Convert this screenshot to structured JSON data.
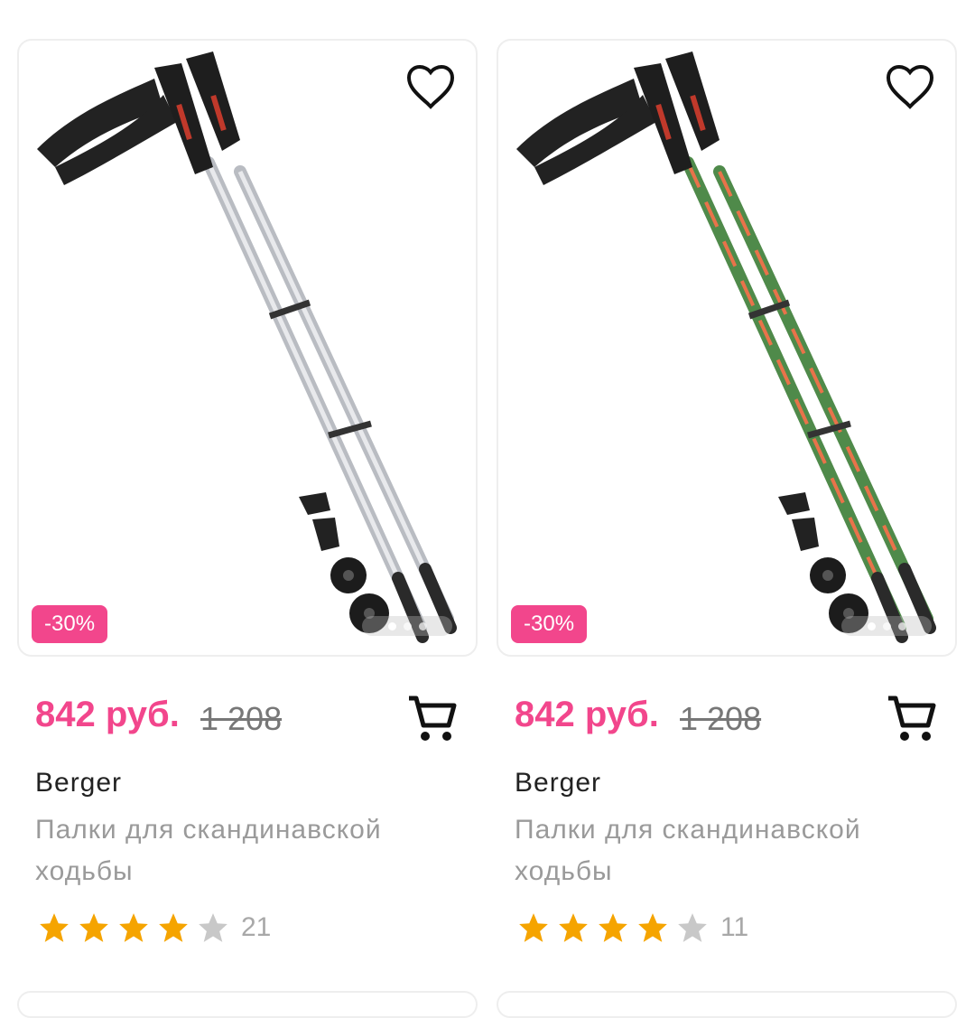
{
  "products": [
    {
      "discount": "-30%",
      "price": "842 руб.",
      "old_price": "1 208",
      "brand": "Berger",
      "title": "Палки для скандинавской ходьбы",
      "rating": 4,
      "rating_max": 5,
      "reviews": "21",
      "shaft_color": "silver",
      "favorite_icon": "heart-outline-icon",
      "cart_icon": "shopping-cart-icon",
      "gallery_index": 1,
      "gallery_total": 3
    },
    {
      "discount": "-30%",
      "price": "842 руб.",
      "old_price": "1 208",
      "brand": "Berger",
      "title": "Палки для скандинавской ходьбы",
      "rating": 4,
      "rating_max": 5,
      "reviews": "11",
      "shaft_color": "green-orange",
      "favorite_icon": "heart-outline-icon",
      "cart_icon": "shopping-cart-icon",
      "gallery_index": 1,
      "gallery_total": 3
    }
  ],
  "colors": {
    "accent": "#f2468c",
    "star_filled": "#f5a400",
    "star_empty": "#c8c8c8",
    "muted_text": "#9a9a9a"
  }
}
